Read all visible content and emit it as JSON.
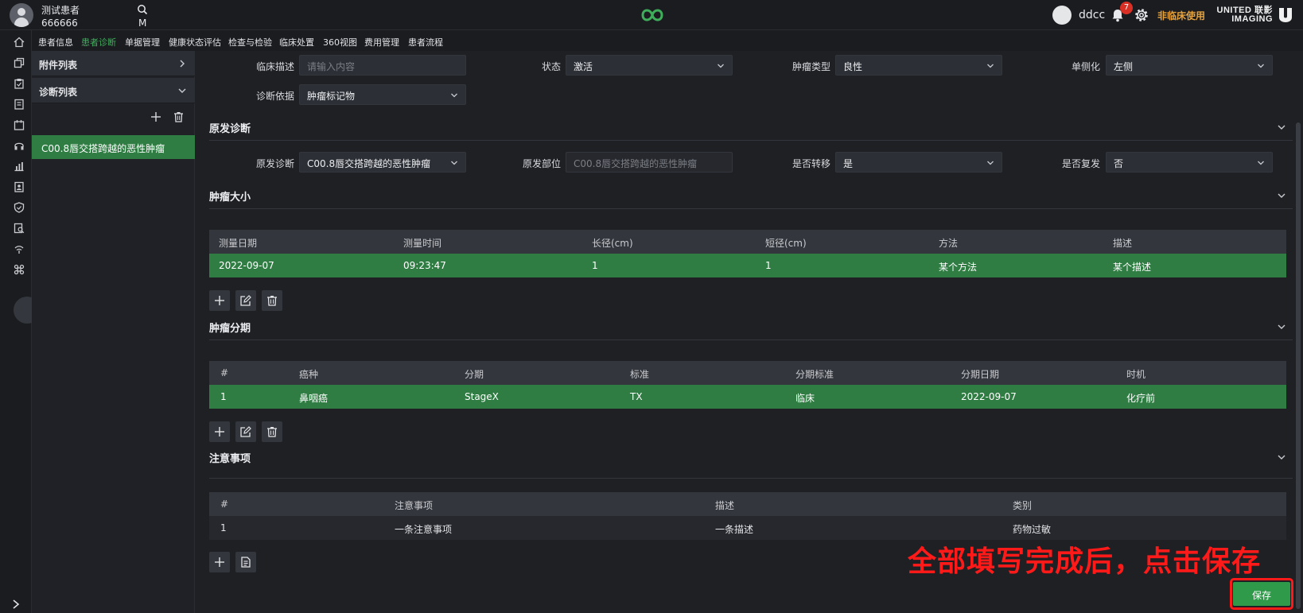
{
  "patient": {
    "name": "测试患者",
    "id": "666666",
    "gender": "M"
  },
  "user": {
    "name": "ddcc",
    "notifications": "7",
    "non_clinical": "非临床使用"
  },
  "brand": {
    "line1": "UNITED 联影",
    "line2": "IMAGING"
  },
  "nav": [
    "患者信息",
    "患者诊断",
    "单据管理",
    "健康状态评估",
    "检查与检验",
    "临床处置",
    "360视图",
    "费用管理",
    "患者流程"
  ],
  "sidebar": {
    "attachments": "附件列表",
    "diagnoses": "诊断列表",
    "items": [
      "C00.8唇交搭跨越的恶性肿瘤"
    ]
  },
  "form": {
    "clinical_desc": {
      "label": "临床描述",
      "placeholder": "请输入内容"
    },
    "status": {
      "label": "状态",
      "value": "激活"
    },
    "tumor_type": {
      "label": "肿瘤类型",
      "value": "良性"
    },
    "laterality": {
      "label": "单侧化",
      "value": "左侧"
    },
    "basis": {
      "label": "诊断依据",
      "value": "肿瘤标记物"
    }
  },
  "primary": {
    "title": "原发诊断",
    "diagnosis": {
      "label": "原发诊断",
      "value": "C00.8唇交搭跨越的恶性肿瘤"
    },
    "site": {
      "label": "原发部位",
      "value": "C00.8唇交搭跨越的恶性肿瘤"
    },
    "metastasis": {
      "label": "是否转移",
      "value": "是"
    },
    "recurrence": {
      "label": "是否复发",
      "value": "否"
    }
  },
  "size": {
    "title": "肿瘤大小",
    "headers": [
      "测量日期",
      "测量时间",
      "长径(cm)",
      "短径(cm)",
      "方法",
      "描述"
    ],
    "rows": [
      [
        "2022-09-07",
        "09:23:47",
        "1",
        "1",
        "某个方法",
        "某个描述"
      ]
    ]
  },
  "staging": {
    "title": "肿瘤分期",
    "headers": [
      "#",
      "癌种",
      "分期",
      "标准",
      "分期标准",
      "分期日期",
      "时机"
    ],
    "rows": [
      [
        "1",
        "鼻咽癌",
        "StageX",
        "TX",
        "临床",
        "2022-09-07",
        "化疗前"
      ]
    ]
  },
  "notes": {
    "title": "注意事项",
    "headers": [
      "#",
      "注意事项",
      "描述",
      "类别"
    ],
    "rows": [
      [
        "1",
        "一条注意事项",
        "一条描述",
        "药物过敏"
      ]
    ]
  },
  "annotation": "全部填写完成后，点击保存",
  "save_label": "保存",
  "colors": {
    "accent": "#3fae5a",
    "row_highlight": "#2f7d43",
    "annotation": "#ff1a1a",
    "warning": "#e6a23c"
  }
}
